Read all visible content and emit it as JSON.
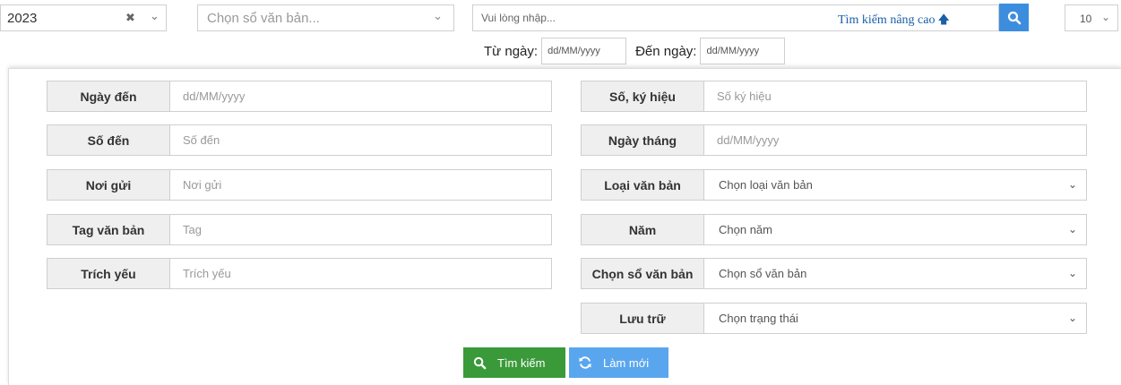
{
  "top": {
    "year_select": {
      "value": "2023",
      "clear": "✖",
      "caret": "⌄"
    },
    "book_select": {
      "placeholder": "Chọn sổ văn bản...",
      "caret": "⌄"
    },
    "search": {
      "placeholder": "Vui lòng nhập...",
      "advanced_label": "Tìm kiếm nâng cao",
      "advanced_icon": "arrow-up-icon"
    },
    "page_size": {
      "value": "10",
      "caret": "⌄"
    },
    "date_range": {
      "from_label": "Từ ngày:",
      "from_placeholder": "dd/MM/yyyy",
      "to_label": "Đến ngày:",
      "to_placeholder": "dd/MM/yyyy"
    }
  },
  "form": {
    "left": [
      {
        "label": "Ngày đến",
        "placeholder": "dd/MM/yyyy"
      },
      {
        "label": "Số đến",
        "placeholder": "Số đến"
      },
      {
        "label": "Nơi gửi",
        "placeholder": "Nơi gửi"
      },
      {
        "label": "Tag văn bản",
        "placeholder": "Tag"
      },
      {
        "label": "Trích yếu",
        "placeholder": "Trích yếu"
      }
    ],
    "right": [
      {
        "label": "Số, ký hiệu",
        "placeholder": "Số ký hiệu"
      },
      {
        "label": "Ngày tháng",
        "placeholder": "dd/MM/yyyy"
      },
      {
        "label": "Loại văn bản",
        "value": "Chọn loại văn bản"
      },
      {
        "label": "Năm",
        "value": "Chọn năm"
      },
      {
        "label": "Chọn sổ văn bản",
        "value": "Chọn sổ văn bản"
      },
      {
        "label": "Lưu trữ",
        "value": "Chọn trạng thái"
      }
    ],
    "chevron": "⌄"
  },
  "buttons": {
    "search_label": "Tìm kiếm",
    "reset_label": "Làm mới"
  },
  "colors": {
    "primary": "#3c8dde",
    "search_button": "#3a9a3a",
    "reset_button": "#5aa6ee",
    "link": "#1a5fa8"
  }
}
